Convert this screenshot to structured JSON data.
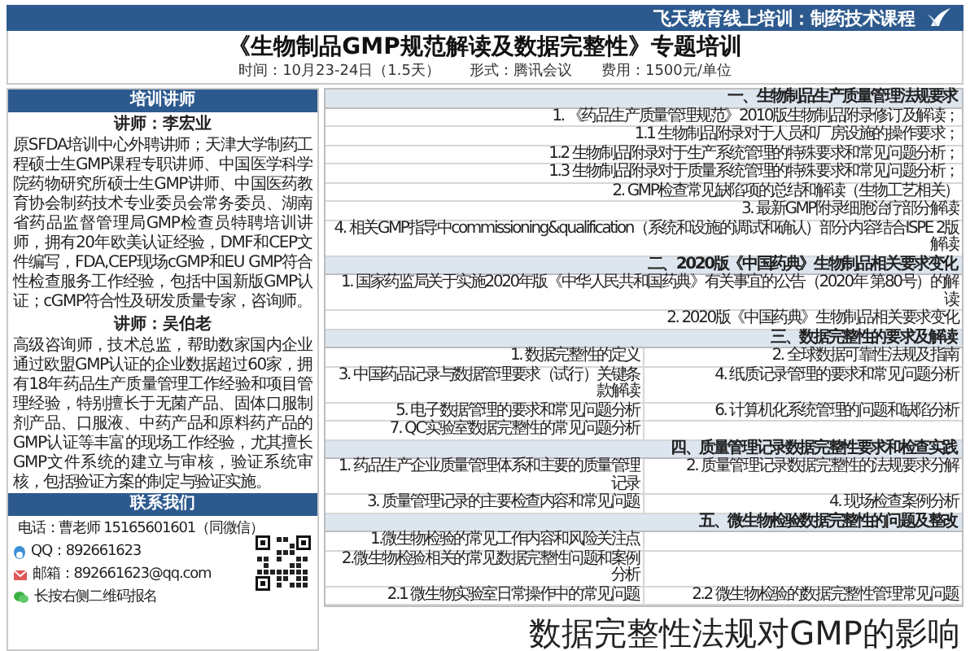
{
  "header": {
    "title": "飞天教育线上培训：制药技术课程"
  },
  "course": {
    "title": "《生物制品GMP规范解读及数据完整性》专题培训",
    "time": "时间：10月23-24日（1.5天）",
    "format": "形式：腾讯会议",
    "fee": "费用：1500元/单位"
  },
  "speakers": {
    "heading": "培训讲师",
    "items": [
      {
        "name": "讲师：李宏业",
        "bio": "原SFDA培训中心外聘讲师；天津大学制药工程硕士生GMP课程专职讲师、中国医学科学院药物研究所硕士生GMP讲师、中国医药教育协会制药技术专业委员会常务委员、湖南省药品监督管理局GMP检查员特聘培训讲师，拥有20年欧美认证经验，DMF和CEP文件编写，FDA,CEP现场cGMP和EU GMP符合性检查服务工作经验，包括中国新版GMP认证；cGMP符合性及研发质量专家，咨询师。"
      },
      {
        "name": "讲师：吴伯老",
        "bio": "高级咨询师，技术总监，帮助数家国内企业通过欧盟GMP认证的企业数据超过60家，拥有18年药品生产质量管理工作经验和项目管理经验，特别擅长于无菌产品、固体口服制剂产品、口服液、中药产品和原料药产品的GMP认证等丰富的现场工作经验，尤其擅长GMP文件系统的建立与审核，验证系统审核，包括验证方案的制定与验证实施。"
      }
    ]
  },
  "contact": {
    "heading": "联系我们",
    "items": [
      {
        "kind": "phone",
        "text": "电话：曹老师 15165601601（同微信）"
      },
      {
        "kind": "qq",
        "text": "QQ：892661623"
      },
      {
        "kind": "email",
        "text": "邮箱：892661623@qq.com"
      },
      {
        "kind": "wechat",
        "text": "长按右侧二维码报名"
      }
    ]
  },
  "agenda": {
    "sections": [
      {
        "title": "一、生物制品生产质量管理法规要求",
        "rows": [
          {
            "cells": [
              "1. 《药品生产质量管理规范》2010版生物制品附录修订及解读；"
            ]
          },
          {
            "cells": [
              "1.1 生物制品附录对于人员和厂房设施的操作要求；"
            ]
          },
          {
            "cells": [
              "1.2 生物制品附录对于生产系统管理的特殊要求和常见问题分析；"
            ]
          },
          {
            "cells": [
              "1.3 生物制品附录对于质量系统管理的特殊要求和常见问题分析；"
            ]
          },
          {
            "cells": [
              "2. GMP检查常见缺陷项的总结和解读（生物工艺相关）"
            ]
          },
          {
            "cells": [
              "3. 最新GMP附录细胞治疗部分解读"
            ]
          },
          {
            "cells": [
              "4. 相关GMP指导中commissioning&qualification（系统和设施的调试和确认）部分内容结合ISPE 2版解读"
            ]
          }
        ]
      },
      {
        "title": "二、2020版《中国药典》生物制品相关要求变化",
        "rows": [
          {
            "cells": [
              "1. 国家药监局关于实施2020年版《中华人民共和国药典》有关事宜的公告（2020年 第80号）的解读"
            ]
          },
          {
            "cells": [
              "2. 2020版《中国药典》生物制品相关要求变化"
            ]
          }
        ]
      },
      {
        "title": "三、数据完整性的要求及解读",
        "rows": [
          {
            "cells": [
              "1. 数据完整性的定义",
              "2. 全球数据可靠性法规及指南"
            ]
          },
          {
            "cells": [
              "3. 中国药品记录与数据管理要求（试行）关键条款解读",
              "4. 纸质记录管理的要求和常见问题分析"
            ]
          },
          {
            "cells": [
              "5. 电子数据管理的要求和常见问题分析",
              "6. 计算机化系统管理的问题和缺陷分析"
            ]
          },
          {
            "cells": [
              "7. QC实验室数据完整性的常见问题分析"
            ]
          }
        ]
      },
      {
        "title": "四、质量管理记录数据完整性要求和检查实践",
        "rows": [
          {
            "cells": [
              "1. 药品生产企业质量管理体系和主要的质量管理记录",
              "2. 质量管理记录数据完整性的法规要求分解"
            ]
          },
          {
            "cells": [
              "3. 质量管理记录的主要检查内容和常见问题",
              "4. 现场检查案例分析"
            ]
          }
        ]
      },
      {
        "title": "五、微生物检验数据完整性的问题及整改",
        "rows": [
          {
            "cells": [
              "1.微生物检验的常见工作内容和风险关注点"
            ]
          },
          {
            "cells": [
              "2.微生物检验相关的常见数据完整性问题和案例分析"
            ]
          },
          {
            "cells": [
              "2.1 微生物实验室日常操作中的常见问题",
              "2.2 微生物检验的数据完整性管理常见问题"
            ]
          }
        ]
      }
    ]
  },
  "caption": "数据完整性法规对GMP的影响"
}
